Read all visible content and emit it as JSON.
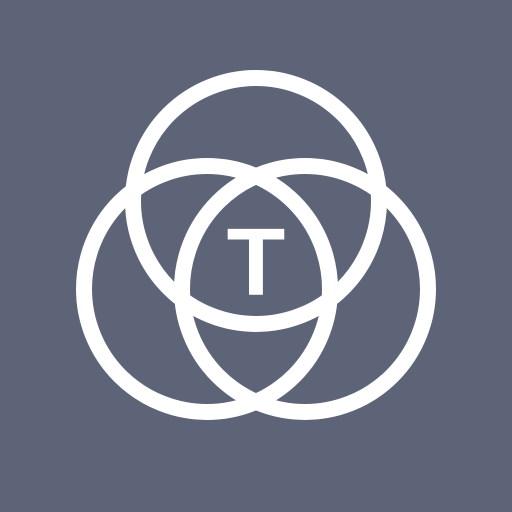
{
  "app_icon": {
    "icon_name": "three-interlocking-circles-logo-icon",
    "background_color": "#5E6477",
    "stroke_color": "#FFFFFF",
    "letter": "T"
  }
}
